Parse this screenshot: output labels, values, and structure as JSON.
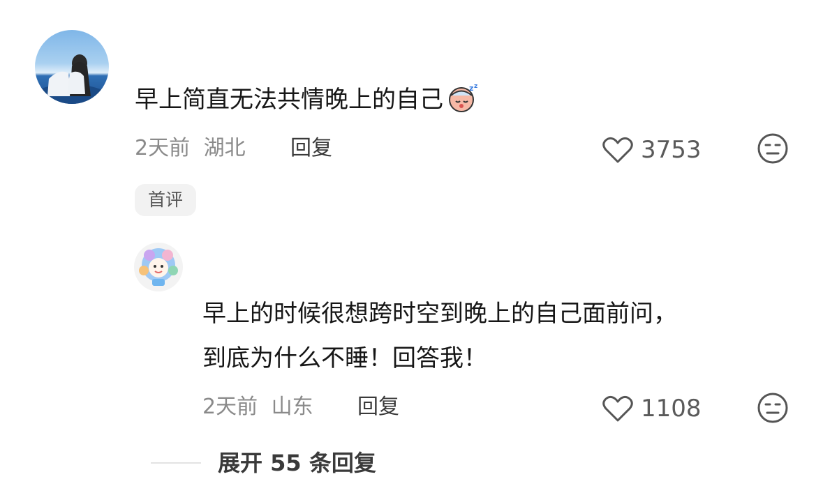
{
  "comments": [
    {
      "text": "早上简直无法共情晚上的自己",
      "emoji": "sleepy-face",
      "time": "2天前",
      "location": "湖北",
      "reply_label": "回复",
      "likes": "3753",
      "badge": "首评"
    },
    {
      "text_line1": "早上的时候很想跨时空到晚上的自己面前问，",
      "text_line2": "到底为什么不睡！回答我！",
      "time": "2天前",
      "location": "山东",
      "reply_label": "回复",
      "likes": "1108"
    }
  ],
  "expand_label": "展开 55 条回复"
}
